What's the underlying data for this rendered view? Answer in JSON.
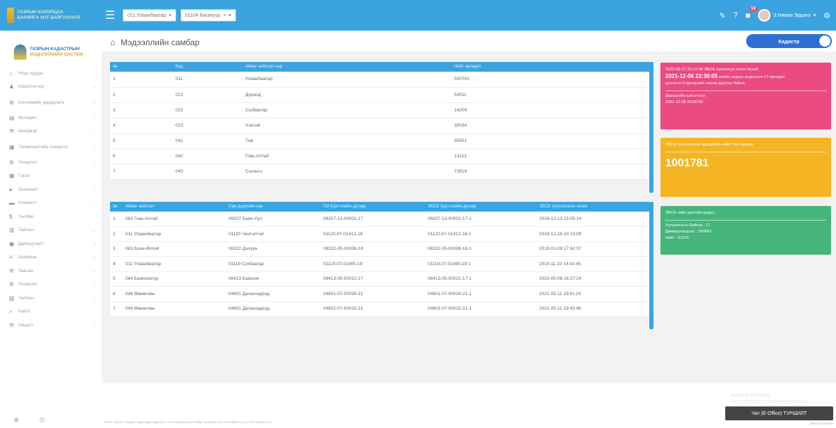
{
  "topbar": {
    "logo_text_1": "ГАЗРЫН ХАРИЛЦАА",
    "logo_text_2": "БАРИЛГА ХОТ БАЙГУУЛАЛТ",
    "aimag_select": "011 Улаанбаатар",
    "sum_select": "01104 Багануур",
    "notif_count": "16",
    "user_name": "З.Нямаа Эрдэнэ"
  },
  "brand": {
    "line1": "ГАЗРЫН КАДАСТРЫН",
    "line2": "МЭДЭЭЛЛИЙН СИСТЕМ"
  },
  "sidebar": {
    "items": [
      {
        "label": "Нүүр хуудас",
        "icon": "home-icon"
      },
      {
        "label": "Хэрэглэгчид",
        "icon": "user-icon"
      },
      {
        "label": "Системийн удирдлага",
        "icon": "cog-icon"
      },
      {
        "label": "Өргөдөл",
        "icon": "file-icon"
      },
      {
        "label": "Шийдвэр",
        "icon": "gavel-icon"
      },
      {
        "label": "Төлөвлөлтийн тохиргоо",
        "icon": "grid-icon"
      },
      {
        "label": "Тохиргоо",
        "icon": "cog-icon"
      },
      {
        "label": "Гэрээ",
        "icon": "grid-icon"
      },
      {
        "label": "Эзэмшил",
        "icon": "circle-icon"
      },
      {
        "label": "Хэмжилт",
        "icon": "ruler-icon"
      },
      {
        "label": "Төлбөр",
        "icon": "dollar-icon"
      },
      {
        "label": "Тайлан",
        "icon": "table-icon"
      },
      {
        "label": "Дамжуулалт",
        "icon": "archive-icon"
      },
      {
        "label": "Архивын",
        "icon": "list-icon"
      },
      {
        "label": "Лавлах",
        "icon": "gavel-icon"
      },
      {
        "label": "Тохиргоо",
        "icon": "cog-icon"
      },
      {
        "label": "Тайлан",
        "icon": "chart-icon"
      },
      {
        "label": "Хайлт",
        "icon": "search-icon"
      },
      {
        "label": "Хяналт",
        "icon": "gavel-icon"
      }
    ]
  },
  "page": {
    "title": "Мэдээллийн самбар",
    "toggle_label": "Кадастр"
  },
  "table1": {
    "headers": [
      "№",
      "Код",
      "Аймаг нийслэл нэр",
      "Нийт өргөдөл"
    ],
    "rows": [
      [
        "1",
        "011",
        "Улаанбаатар",
        "500762"
      ],
      [
        "2",
        "021",
        "Дорнод",
        "54011"
      ],
      [
        "3",
        "022",
        "Сүхбаатар",
        "14209"
      ],
      [
        "4",
        "023",
        "Хэнтий",
        "30034"
      ],
      [
        "5",
        "041",
        "Төв",
        "95551"
      ],
      [
        "6",
        "042",
        "Говь-Алтай",
        "13113"
      ],
      [
        "7",
        "043",
        "Сэлэнгэ",
        "73519"
      ]
    ]
  },
  "table2": {
    "headers": [
      "№",
      "Аймаг нийслэл",
      "Сум дүүргийн нэр",
      "ГМ бүртгэлийн дугаар",
      "ЭБСЕ бүртгэлийн дугаар",
      "ЭБСЕ хүлээлгэсэн огноо"
    ],
    "rows": [
      [
        "1",
        "082 Говь-Алтай",
        "08207 Баян-Уул",
        "08207-13-00001-17",
        "08207-13-00001-17-1",
        "2018-12-13 15:05:14"
      ],
      [
        "2",
        "011 Улаанбаатар",
        "01120 Чингэлтэй",
        "01120-07-01412-18",
        "01120-07-01412-18-2",
        "2018-12-26 10:13:09"
      ],
      [
        "3",
        "083 Баян-Өлгий",
        "08322 Дэлүүн",
        "08322-05-00006-18",
        "08322-05-00006-18-1",
        "2019-01-09 17:42:37"
      ],
      [
        "4",
        "011 Улаанбаатар",
        "01119 Сүхбаатар",
        "01119-07-01485-19",
        "01119-07-01485-19-1",
        "2019-11-23 14:43:45"
      ],
      [
        "5",
        "064 Баянхонгор",
        "06413 Баянлиг",
        "06413-05-00021-17",
        "06413-05-00021-17-1",
        "2020-05-08 16:27:24"
      ],
      [
        "6",
        "046 Өмнөговь",
        "04601 Даланзадгад",
        "04601-07-00034-21",
        "04601-07-00034-21-1",
        "2021-05-11 19:41:24"
      ],
      [
        "7",
        "046 Өмнөговь",
        "04601 Даланзадгад",
        "04601-07-00032-21",
        "04601-07-00032-21-1",
        "2021-05-11 19:43:46"
      ]
    ]
  },
  "card_pink": {
    "line1": "2022-08-17 16:12:08 ЭБСЕ хүлээлгэх огноо бүхий",
    "highlight": "2021-12-06 22:30:05",
    "line2": "үеийн газрын мэдээлэл 17 өргөдөл",
    "line3": "үүсгэсэн 0 өргөдлийг хянаж дуусгах байна",
    "footer1": "Дараагийн шинэчлэл:",
    "footer2": "2021-12-08 23:00:00",
    "color": "#ec4a83"
  },
  "card_yellow": {
    "text": "ЭБСЕ хүлээлгэсэн өргөдлийн нийт тоо хэмжээ",
    "value": "1001781",
    "color": "#f5b523"
  },
  "card_green": {
    "title": "ЭБСЕ нийт дүнгийн мэдээ",
    "line1": "Хүлээлгэсэн байгаа : 17",
    "line2": "Дамжуулагдсан : 100843",
    "line3": "Нийт : 21101",
    "color": "#46b57b"
  },
  "footer": {
    "text": "2019 - 2022 © Газрын Харилцаа, Барилга, Хот Байгуулалтын Газар. Developed by Anod Bank LLC & Soft Bridge LLC"
  },
  "chat": {
    "label": "Чат (E-Office) ТУРШИЛТ",
    "ghost1": "Activate Windows",
    "ghost2": "Go to Settings to activate Windows.",
    "corner": "Terms of Service"
  }
}
